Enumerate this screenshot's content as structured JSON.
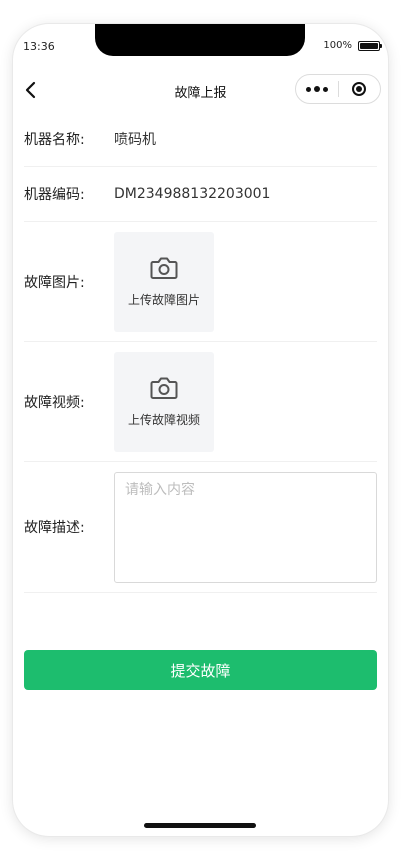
{
  "status_bar": {
    "time": "13:36",
    "battery": "100%"
  },
  "navbar": {
    "title": "故障上报",
    "back_icon": "chevron-left-icon",
    "menu_icon": "more-dots-icon",
    "close_icon": "target-icon"
  },
  "form": {
    "machine_name": {
      "label": "机器名称:",
      "value": "喷码机"
    },
    "machine_code": {
      "label": "机器编码:",
      "value": "DM234988132203001"
    },
    "fault_image": {
      "label": "故障图片:",
      "upload_label": "上传故障图片",
      "icon": "camera-icon"
    },
    "fault_video": {
      "label": "故障视频:",
      "upload_label": "上传故障视频",
      "icon": "camera-icon"
    },
    "fault_desc": {
      "label": "故障描述:",
      "placeholder": "请输入内容",
      "value": ""
    }
  },
  "submit": {
    "label": "提交故障"
  },
  "colors": {
    "primary": "#1dbd6e",
    "upload_bg": "#f4f5f7"
  }
}
